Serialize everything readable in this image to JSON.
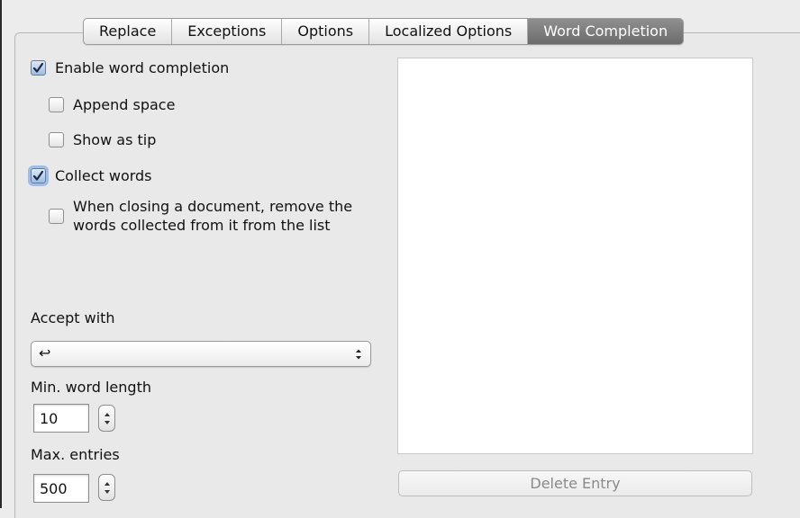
{
  "tabs": [
    {
      "label": "Replace",
      "active": false
    },
    {
      "label": "Exceptions",
      "active": false
    },
    {
      "label": "Options",
      "active": false
    },
    {
      "label": "Localized Options",
      "active": false
    },
    {
      "label": "Word Completion",
      "active": true
    }
  ],
  "checkboxes": {
    "enable_word_completion": {
      "label": "Enable word completion",
      "checked": true
    },
    "append_space": {
      "label": "Append space",
      "checked": false
    },
    "show_as_tip": {
      "label": "Show as tip",
      "checked": false
    },
    "collect_words": {
      "label": "Collect words",
      "checked": true
    },
    "remove_on_close": {
      "label": "When closing a document, remove the words collected from it from the list",
      "checked": false
    }
  },
  "accept_with": {
    "label": "Accept with",
    "value": "↩"
  },
  "min_word_length": {
    "label": "Min. word length",
    "value": "10"
  },
  "max_entries": {
    "label": "Max. entries",
    "value": "500"
  },
  "delete_entry_label": "Delete Entry",
  "colors": {
    "active_tab": "#7a7a7a",
    "checkbox_checked": "#9fbbe0",
    "focus_ring": "#6ea0e6"
  }
}
